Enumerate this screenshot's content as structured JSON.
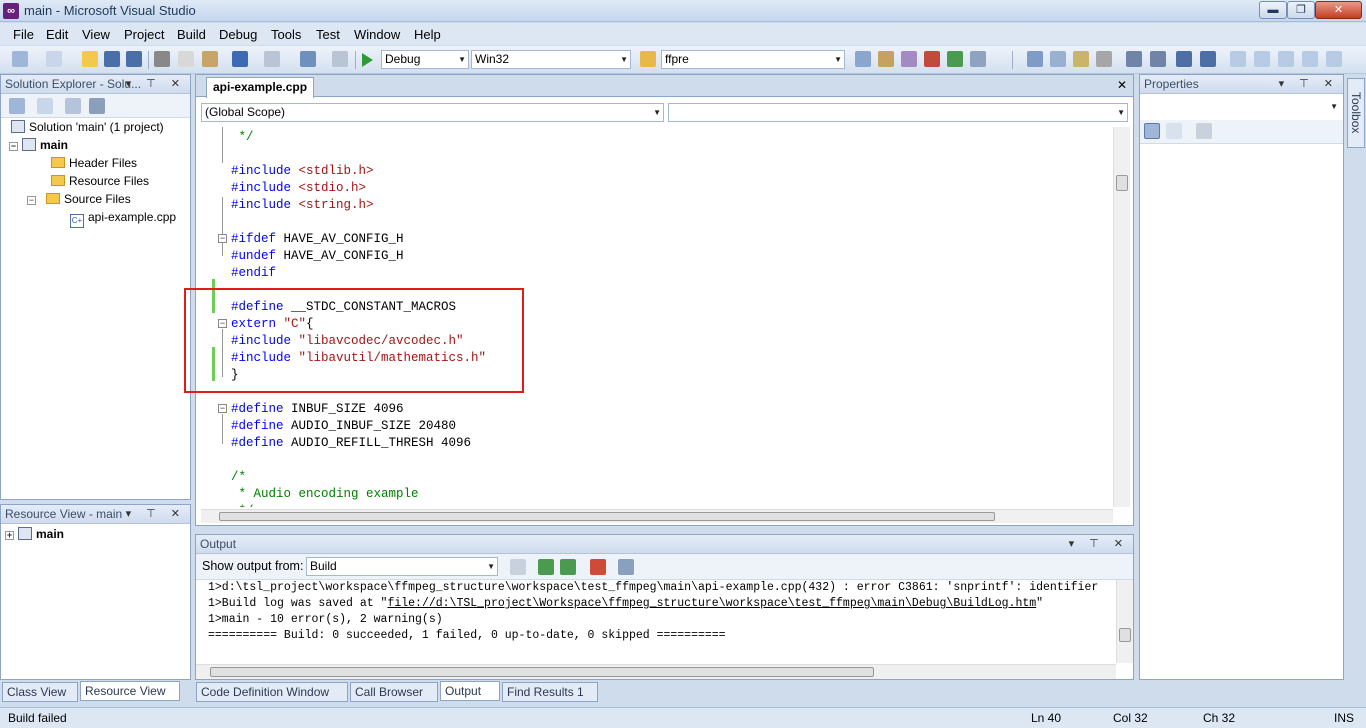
{
  "window": {
    "title": "main - Microsoft Visual Studio",
    "icon_glyph": "∞"
  },
  "menu": [
    "File",
    "Edit",
    "View",
    "Project",
    "Build",
    "Debug",
    "Tools",
    "Test",
    "Window",
    "Help"
  ],
  "toolbar": {
    "config": "Debug",
    "platform": "Win32",
    "find": "ffpre"
  },
  "solution_explorer": {
    "title": "Solution Explorer - Solu...",
    "items": [
      {
        "label": "Solution 'main' (1 project)",
        "type": "solution"
      },
      {
        "label": "main",
        "type": "project"
      },
      {
        "label": "Header Files",
        "type": "folder"
      },
      {
        "label": "Resource Files",
        "type": "folder"
      },
      {
        "label": "Source Files",
        "type": "folder"
      },
      {
        "label": "api-example.cpp",
        "type": "file"
      }
    ]
  },
  "resource_view": {
    "title": "Resource View - main",
    "root": "main"
  },
  "left_tabs": {
    "class_view": "Class View",
    "resource_view": "Resource View"
  },
  "editor": {
    "tab": "api-example.cpp",
    "scope": "(Global Scope)",
    "lines": [
      {
        "parts": [
          [
            "cmt",
            " */"
          ]
        ]
      },
      {
        "parts": []
      },
      {
        "parts": [
          [
            "kw",
            "#include"
          ],
          [
            "",
            " "
          ],
          [
            "str",
            "<stdlib.h>"
          ]
        ]
      },
      {
        "parts": [
          [
            "kw",
            "#include"
          ],
          [
            "",
            " "
          ],
          [
            "str",
            "<stdio.h>"
          ]
        ]
      },
      {
        "parts": [
          [
            "kw",
            "#include"
          ],
          [
            "",
            " "
          ],
          [
            "str",
            "<string.h>"
          ]
        ]
      },
      {
        "parts": []
      },
      {
        "parts": [
          [
            "kw",
            "#ifdef"
          ],
          [
            "",
            " HAVE_AV_CONFIG_H"
          ]
        ]
      },
      {
        "parts": [
          [
            "kw",
            "#undef"
          ],
          [
            "",
            " HAVE_AV_CONFIG_H"
          ]
        ]
      },
      {
        "parts": [
          [
            "kw",
            "#endif"
          ]
        ]
      },
      {
        "parts": []
      },
      {
        "parts": [
          [
            "kw",
            "#define"
          ],
          [
            "",
            " __STDC_CONSTANT_MACROS"
          ]
        ]
      },
      {
        "parts": [
          [
            "kw",
            "extern"
          ],
          [
            "",
            " "
          ],
          [
            "str",
            "\"C\""
          ],
          [
            "",
            "{"
          ]
        ]
      },
      {
        "parts": [
          [
            "kw",
            "#include"
          ],
          [
            "",
            " "
          ],
          [
            "str",
            "\"libavcodec/avcodec.h\""
          ]
        ]
      },
      {
        "parts": [
          [
            "kw",
            "#include"
          ],
          [
            "",
            " "
          ],
          [
            "str",
            "\"libavutil/mathematics.h\""
          ]
        ]
      },
      {
        "parts": [
          [
            "",
            "}"
          ]
        ]
      },
      {
        "parts": []
      },
      {
        "parts": [
          [
            "kw",
            "#define"
          ],
          [
            "",
            " INBUF_SIZE 4096"
          ]
        ]
      },
      {
        "parts": [
          [
            "kw",
            "#define"
          ],
          [
            "",
            " AUDIO_INBUF_SIZE 20480"
          ]
        ]
      },
      {
        "parts": [
          [
            "kw",
            "#define"
          ],
          [
            "",
            " AUDIO_REFILL_THRESH 4096"
          ]
        ]
      },
      {
        "parts": []
      },
      {
        "parts": [
          [
            "cmt",
            "/*"
          ]
        ]
      },
      {
        "parts": [
          [
            "cmt",
            " * Audio encoding example"
          ]
        ]
      },
      {
        "parts": [
          [
            "cmt",
            " */"
          ]
        ]
      }
    ]
  },
  "output": {
    "title": "Output",
    "show_from_label": "Show output from:",
    "source": "Build",
    "lines": [
      {
        "text": "1>d:\\tsl_project\\workspace\\ffmpeg_structure\\workspace\\test_ffmpeg\\main\\api-example.cpp(432) : error C3861: 'snprintf': identifier"
      },
      {
        "prefix": "1>Build log was saved at \"",
        "link": "file://d:\\TSL_project\\Workspace\\ffmpeg_structure\\workspace\\test_ffmpeg\\main\\Debug\\BuildLog.htm",
        "suffix": "\""
      },
      {
        "text": "1>main - 10 error(s), 2 warning(s)"
      },
      {
        "text": "========== Build: 0 succeeded, 1 failed, 0 up-to-date, 0 skipped =========="
      }
    ]
  },
  "bottom_tabs": [
    "Code Definition Window",
    "Call Browser",
    "Output",
    "Find Results 1"
  ],
  "properties": {
    "title": "Properties"
  },
  "toolbox": "Toolbox",
  "status": {
    "message": "Build failed",
    "ln": "Ln 40",
    "col": "Col 32",
    "ch": "Ch 32",
    "mode": "INS"
  }
}
